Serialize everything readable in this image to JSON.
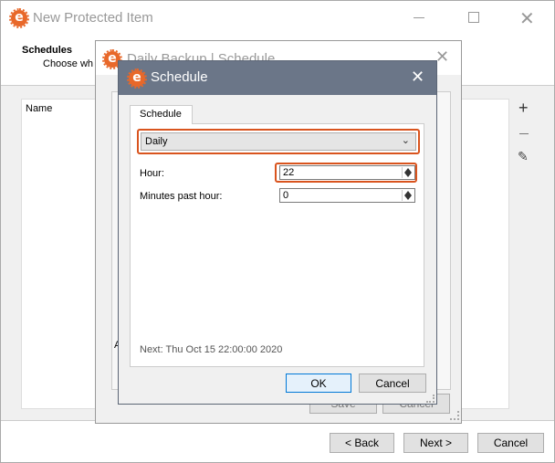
{
  "main_window": {
    "title": "New Protected Item",
    "header_title": "Schedules",
    "header_subtitle": "Choose wh",
    "list_column": "Name",
    "back_button": "< Back",
    "next_button": "Next >",
    "cancel_button": "Cancel"
  },
  "mid_window": {
    "title": "Daily Backup | Schedule",
    "side_label": "A",
    "save_button": "Save",
    "cancel_button": "Cancel"
  },
  "dialog": {
    "title": "Schedule",
    "tab_label": "Schedule",
    "frequency_value": "Daily",
    "hour_label": "Hour:",
    "hour_value": "22",
    "minutes_label": "Minutes past hour:",
    "minutes_value": "0",
    "next_run": "Next: Thu Oct 15 22:00:00 2020",
    "ok_button": "OK",
    "cancel_button": "Cancel"
  },
  "colors": {
    "dialog_titlebar": "#6b7688",
    "highlight": "#d9541e",
    "brand": "#e8682a"
  },
  "icons": [
    "app-logo-icon",
    "minimize-icon",
    "maximize-icon",
    "close-icon",
    "add-icon",
    "remove-icon",
    "edit-icon",
    "resize-grip-icon"
  ]
}
